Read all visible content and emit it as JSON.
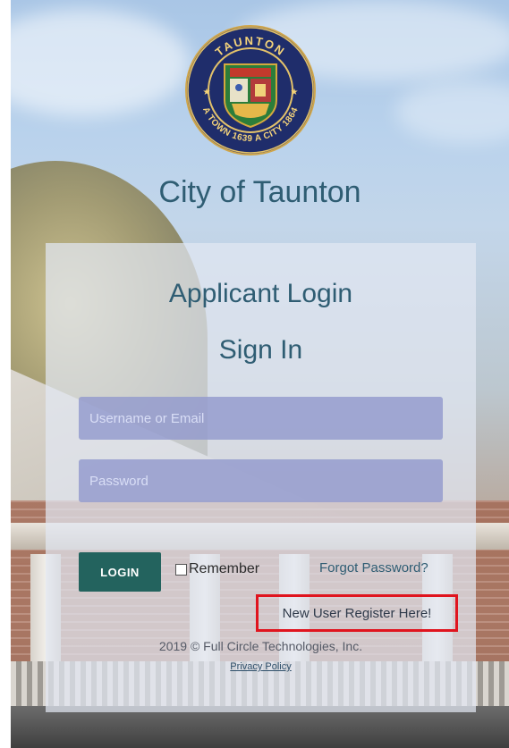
{
  "seal": {
    "top_text": "TAUNTON",
    "bottom_text": "A TOWN 1639 A CITY 1864"
  },
  "header": {
    "city_title": "City of Taunton"
  },
  "login_panel": {
    "title": "Applicant Login",
    "subtitle": "Sign In",
    "username_placeholder": "Username or Email",
    "password_placeholder": "Password",
    "login_label": "LOGIN",
    "remember_label": "Remember",
    "forgot_label": "Forgot Password?",
    "register_label": "New User Register Here!",
    "copyright": "2019 © Full Circle Technologies, Inc.",
    "privacy_label": "Privacy Policy"
  },
  "colors": {
    "title_text": "#2f5d73",
    "login_button": "#23635e",
    "input_fill": "#929acd",
    "register_highlight": "#e0141e"
  }
}
